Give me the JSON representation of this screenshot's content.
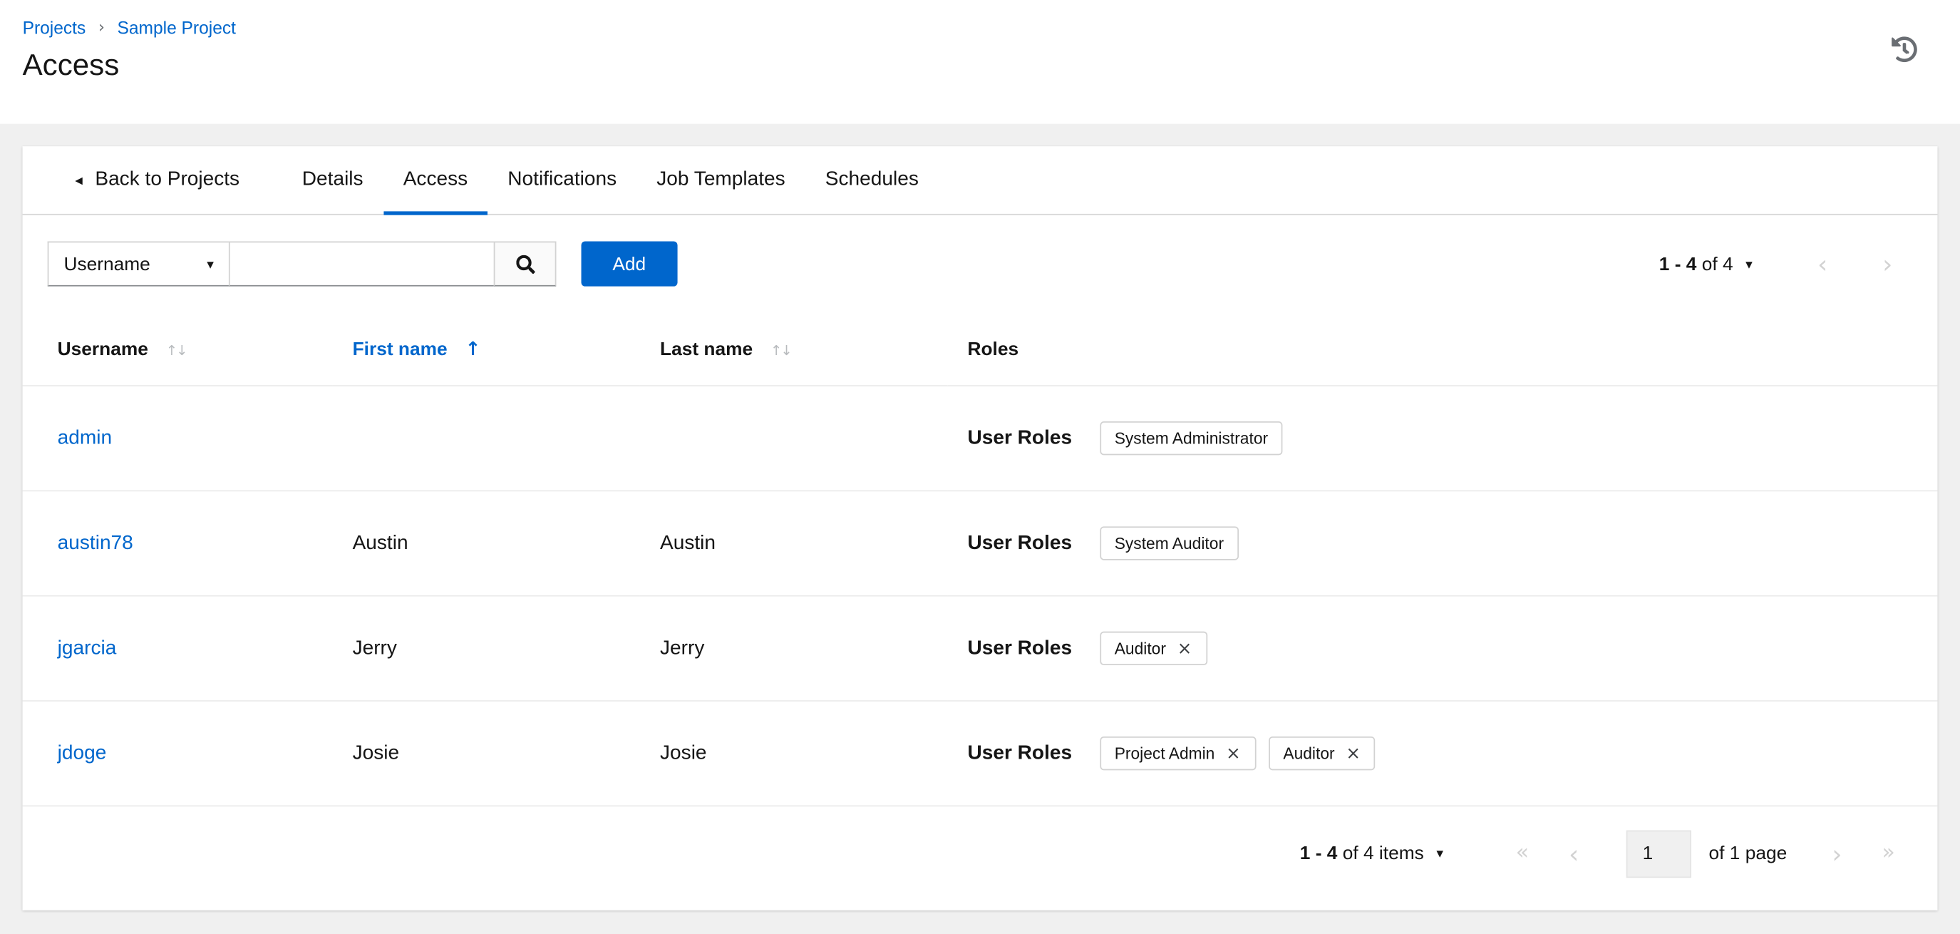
{
  "breadcrumb": {
    "items": [
      "Projects",
      "Sample Project"
    ],
    "separator": "›"
  },
  "page": {
    "title": "Access"
  },
  "tabs": {
    "back_label": "Back to Projects",
    "items": [
      {
        "label": "Details",
        "active": false
      },
      {
        "label": "Access",
        "active": true
      },
      {
        "label": "Notifications",
        "active": false
      },
      {
        "label": "Job Templates",
        "active": false
      },
      {
        "label": "Schedules",
        "active": false
      }
    ]
  },
  "toolbar": {
    "filter_dropdown_value": "Username",
    "search_value": "",
    "add_button_label": "Add",
    "pagination": {
      "range": "1 - 4",
      "suffix": "of 4"
    }
  },
  "table": {
    "columns": [
      {
        "label": "Username",
        "sortable": true,
        "sorted": false
      },
      {
        "label": "First name",
        "sortable": true,
        "sorted": "asc"
      },
      {
        "label": "Last name",
        "sortable": true,
        "sorted": false
      },
      {
        "label": "Roles",
        "sortable": false,
        "sorted": false
      }
    ],
    "roles_label": "User Roles",
    "rows": [
      {
        "username": "admin",
        "first_name": "",
        "last_name": "",
        "roles": [
          {
            "label": "System Administrator",
            "removable": false
          }
        ]
      },
      {
        "username": "austin78",
        "first_name": "Austin",
        "last_name": "Austin",
        "roles": [
          {
            "label": "System Auditor",
            "removable": false
          }
        ]
      },
      {
        "username": "jgarcia",
        "first_name": "Jerry",
        "last_name": "Jerry",
        "roles": [
          {
            "label": "Auditor",
            "removable": true
          }
        ]
      },
      {
        "username": "jdoge",
        "first_name": "Josie",
        "last_name": "Josie",
        "roles": [
          {
            "label": "Project Admin",
            "removable": true
          },
          {
            "label": "Auditor",
            "removable": true
          }
        ]
      }
    ]
  },
  "footer": {
    "pagination": {
      "range": "1 - 4",
      "suffix": "of 4 items"
    },
    "current_page": "1",
    "page_label": "of 1 page"
  },
  "icons": {
    "back": "◂",
    "caret_down": "▾",
    "sort_unsorted": "↑↓",
    "sort_asc": "↑",
    "chevron_left": "‹",
    "chevron_right": "›",
    "chevron_double_left": "«",
    "chevron_double_right": "»",
    "close": "×"
  },
  "colors": {
    "link": "#0066cc",
    "primary_button": "#0066cc",
    "page_background": "#f0f0f0",
    "card_background": "#ffffff",
    "border": "#d2d2d2",
    "row_border": "#ebebeb",
    "text": "#151515",
    "muted": "#6a6e73",
    "disabled_chevron": "#d2d2d2"
  }
}
